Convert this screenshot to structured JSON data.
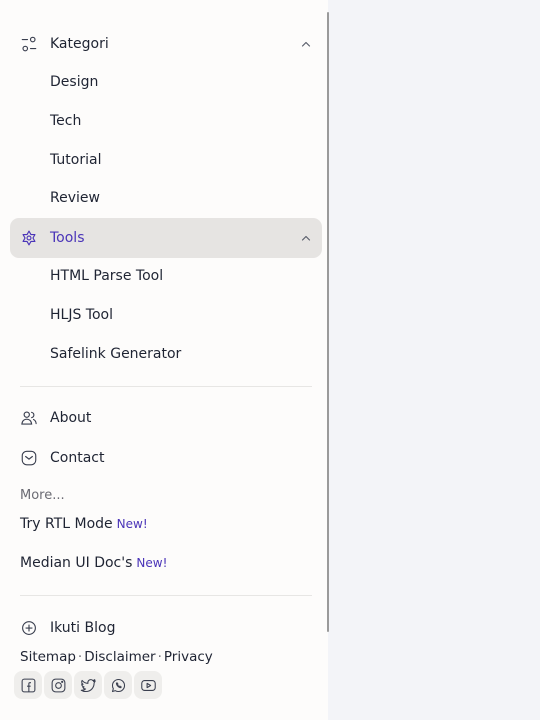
{
  "nav": {
    "kategori": {
      "label": "Kategori",
      "icon": "filter-icon",
      "items": [
        "Design",
        "Tech",
        "Tutorial",
        "Review"
      ]
    },
    "tools": {
      "label": "Tools",
      "icon": "tools-icon",
      "items": [
        "HTML Parse Tool",
        "HLJS Tool",
        "Safelink Generator"
      ]
    },
    "about": {
      "label": "About",
      "icon": "users-icon"
    },
    "contact": {
      "label": "Contact",
      "icon": "message-icon"
    }
  },
  "more": {
    "label": "More...",
    "rtl": {
      "label": "Try RTL Mode",
      "badge": "New!"
    },
    "docs": {
      "label": "Median UI Doc's",
      "badge": "New!"
    }
  },
  "extra": {
    "label": "Ikuti Blog",
    "icon": "plus-circle-icon"
  },
  "footer": {
    "links": [
      "Sitemap",
      "Disclaimer",
      "Privacy"
    ],
    "separator": "·",
    "socials": [
      "facebook-icon",
      "instagram-icon",
      "twitter-icon",
      "whatsapp-icon",
      "youtube-icon"
    ]
  },
  "colors": {
    "accent": "#4a34b8",
    "active_bg": "#e6e4e2",
    "drawer_bg": "#fdfcfb",
    "page_bg": "#f3f4f8"
  }
}
